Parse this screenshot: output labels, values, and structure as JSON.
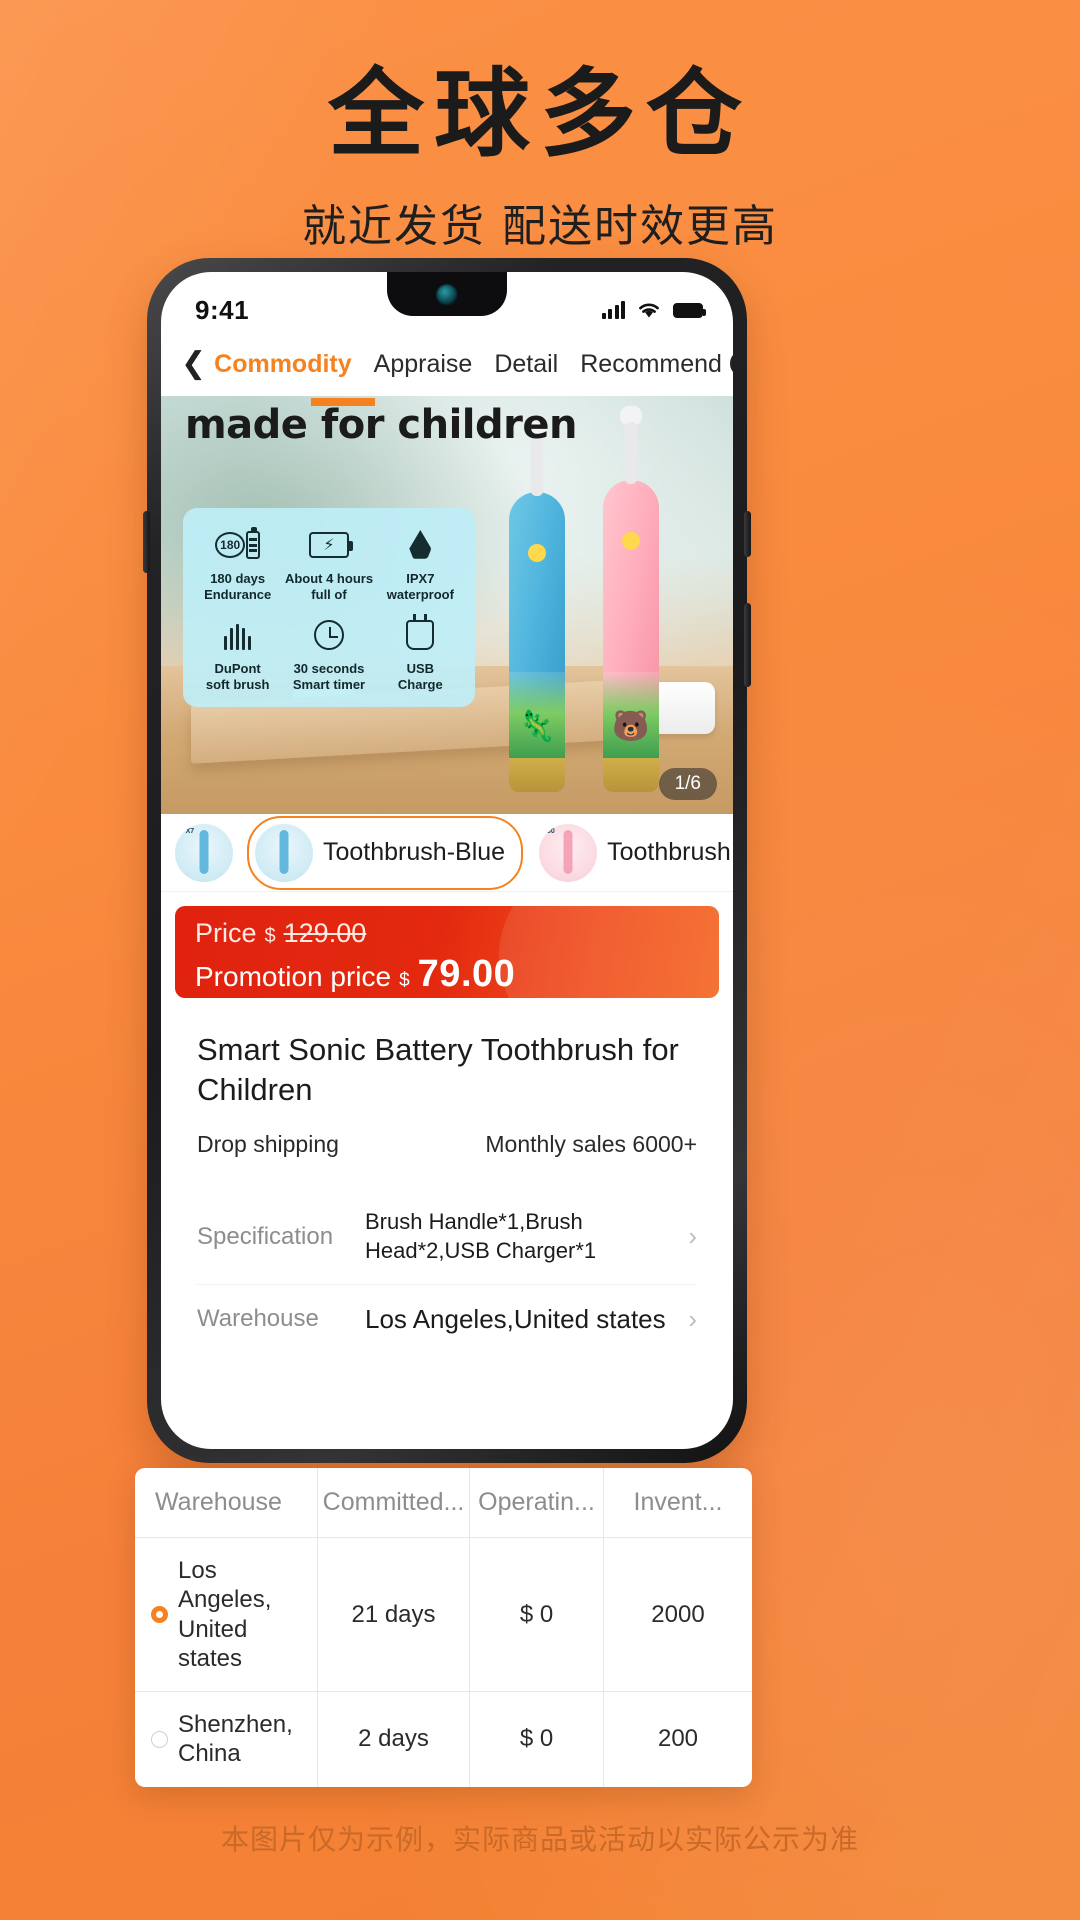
{
  "poster": {
    "headline": "全球多仓",
    "subheadline": "就近发货 配送时效更高",
    "disclaimer": "本图片仅为示例，实际商品或活动以实际公示为准",
    "bg_color": "#f9883c",
    "accent_color": "#f5821f"
  },
  "status_bar": {
    "time": "9:41",
    "signal_icon": "signal-bars-icon",
    "wifi_icon": "wifi-icon",
    "battery_icon": "battery-icon"
  },
  "navbar": {
    "back_icon": "chevron-left-icon",
    "tabs": [
      {
        "label": "Commodity",
        "active": true
      },
      {
        "label": "Appraise",
        "active": false
      },
      {
        "label": "Detail",
        "active": false
      },
      {
        "label": "Recommend",
        "active": false
      }
    ],
    "search_icon": "search-icon",
    "more_icon": "more-dots-icon"
  },
  "hero": {
    "banner_text": "made for children",
    "image_counter": "1/6",
    "features": [
      {
        "icon": "battery-180-icon",
        "line1": "180 days",
        "line2": "Endurance"
      },
      {
        "icon": "fast-charge-icon",
        "line1": "About 4 hours",
        "line2": "full of"
      },
      {
        "icon": "water-drop-icon",
        "line1": "IPX7",
        "line2": "waterproof"
      },
      {
        "icon": "bristles-icon",
        "line1": "DuPont",
        "line2": "soft brush"
      },
      {
        "icon": "timer-icon",
        "line1": "30 seconds",
        "line2": "Smart timer"
      },
      {
        "icon": "usb-charge-icon",
        "line1": "USB",
        "line2": "Charge"
      }
    ]
  },
  "sku_strip": {
    "items": [
      {
        "name": "",
        "selected": false,
        "tone": "blue"
      },
      {
        "name": "Toothbrush-Blue",
        "selected": true,
        "tone": "blue"
      },
      {
        "name": "Toothbrush",
        "selected": false,
        "tone": "pink"
      }
    ]
  },
  "price": {
    "original_label": "Price",
    "currency": "$",
    "original_value": "129.00",
    "promo_label": "Promotion price",
    "promo_value": "79.00"
  },
  "product": {
    "title": "Smart Sonic Battery Toothbrush for Children",
    "shipping_label": "Drop shipping",
    "monthly_sales": "Monthly sales 6000+"
  },
  "spec_rows": [
    {
      "key": "Specification",
      "value": "Brush Handle*1,Brush Head*2,USB Charger*1",
      "chevron": "›"
    },
    {
      "key": "Warehouse",
      "value": "Los Angeles,United states",
      "chevron": "›"
    }
  ],
  "warehouse_table": {
    "headers": [
      "Warehouse",
      "Committed...",
      "Operatin...",
      "Invent..."
    ],
    "rows": [
      {
        "selected": true,
        "warehouse_line1": "Los Angeles,",
        "warehouse_line2": "United states",
        "committed": "21 days",
        "operating": "$ 0",
        "inventory": "2000"
      },
      {
        "selected": false,
        "warehouse_line1": "Shenzhen,",
        "warehouse_line2": "China",
        "committed": "2 days",
        "operating": "$ 0",
        "inventory": "200"
      }
    ]
  }
}
